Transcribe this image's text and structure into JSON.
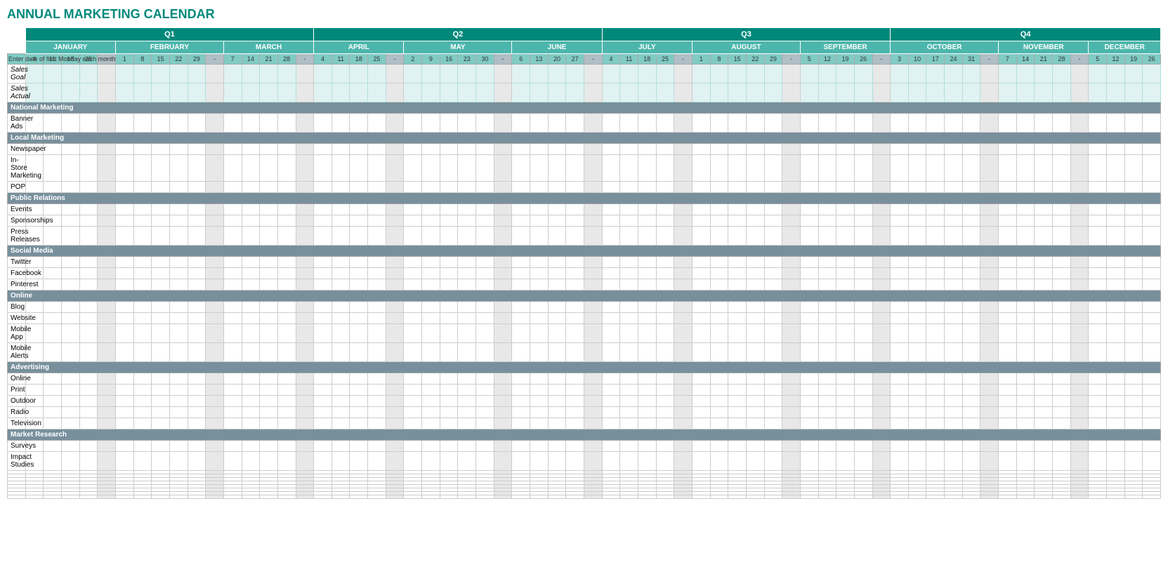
{
  "title": "ANNUAL MARKETING CALENDAR",
  "quarters": [
    {
      "label": "Q1",
      "span": 14
    },
    {
      "label": "Q2",
      "span": 13
    },
    {
      "label": "Q3",
      "span": 14
    },
    {
      "label": "Q4",
      "span": 13
    }
  ],
  "months": [
    {
      "label": "JANUARY",
      "dates": [
        "4",
        "11",
        "18",
        "25"
      ],
      "sep": true
    },
    {
      "label": "FEBRUARY",
      "dates": [
        "1",
        "8",
        "15",
        "22",
        "29"
      ],
      "sep": true
    },
    {
      "label": "MARCH",
      "dates": [
        "7",
        "14",
        "21",
        "28"
      ],
      "sep": true
    },
    {
      "label": "APRIL",
      "dates": [
        "4",
        "11",
        "18",
        "25"
      ],
      "sep": true
    },
    {
      "label": "MAY",
      "dates": [
        "2",
        "9",
        "16",
        "23",
        "30"
      ],
      "sep": true
    },
    {
      "label": "JUNE",
      "dates": [
        "6",
        "13",
        "20",
        "27"
      ],
      "sep": true
    },
    {
      "label": "JULY",
      "dates": [
        "4",
        "11",
        "18",
        "25"
      ],
      "sep": true
    },
    {
      "label": "AUGUST",
      "dates": [
        "1",
        "8",
        "15",
        "22",
        "29"
      ],
      "sep": true
    },
    {
      "label": "SEPTEMBER",
      "dates": [
        "5",
        "12",
        "19",
        "26"
      ],
      "sep": true
    },
    {
      "label": "OCTOBER",
      "dates": [
        "3",
        "10",
        "17",
        "24",
        "31"
      ],
      "sep": true
    },
    {
      "label": "NOVEMBER",
      "dates": [
        "7",
        "14",
        "21",
        "28"
      ],
      "sep": true
    },
    {
      "label": "DECEMBER",
      "dates": [
        "5",
        "12",
        "19",
        "26"
      ],
      "sep": false
    }
  ],
  "date_label": "Enter date of first Monday each month",
  "rows": [
    {
      "type": "sales",
      "label": "Sales Goal"
    },
    {
      "type": "sales",
      "label": "Sales Actual"
    },
    {
      "type": "category",
      "label": "National Marketing"
    },
    {
      "type": "data",
      "label": "Banner Ads"
    },
    {
      "type": "category",
      "label": "Local Marketing"
    },
    {
      "type": "data",
      "label": "Newspaper"
    },
    {
      "type": "data",
      "label": "In-Store Marketing"
    },
    {
      "type": "data",
      "label": "POP"
    },
    {
      "type": "category",
      "label": "Public Relations"
    },
    {
      "type": "data",
      "label": "Events"
    },
    {
      "type": "data",
      "label": "Sponsorships"
    },
    {
      "type": "data",
      "label": "Press Releases"
    },
    {
      "type": "category",
      "label": "Social Media"
    },
    {
      "type": "data",
      "label": "Twitter"
    },
    {
      "type": "data",
      "label": "Facebook"
    },
    {
      "type": "data",
      "label": "Pinterest"
    },
    {
      "type": "category",
      "label": "Online"
    },
    {
      "type": "data",
      "label": "Blog"
    },
    {
      "type": "data",
      "label": "Website"
    },
    {
      "type": "data",
      "label": "Mobile App"
    },
    {
      "type": "data",
      "label": "Mobile Alerts"
    },
    {
      "type": "category",
      "label": "Advertising"
    },
    {
      "type": "data",
      "label": "Online"
    },
    {
      "type": "data",
      "label": "Print"
    },
    {
      "type": "data",
      "label": "Outdoor"
    },
    {
      "type": "data",
      "label": "Radio"
    },
    {
      "type": "data",
      "label": "Television"
    },
    {
      "type": "category",
      "label": "Market Research"
    },
    {
      "type": "data",
      "label": "Surveys"
    },
    {
      "type": "data",
      "label": "Impact Studies"
    },
    {
      "type": "empty",
      "label": ""
    },
    {
      "type": "empty",
      "label": ""
    },
    {
      "type": "empty",
      "label": ""
    },
    {
      "type": "empty",
      "label": ""
    },
    {
      "type": "empty",
      "label": ""
    },
    {
      "type": "empty",
      "label": ""
    },
    {
      "type": "empty",
      "label": ""
    },
    {
      "type": "empty",
      "label": ""
    }
  ]
}
